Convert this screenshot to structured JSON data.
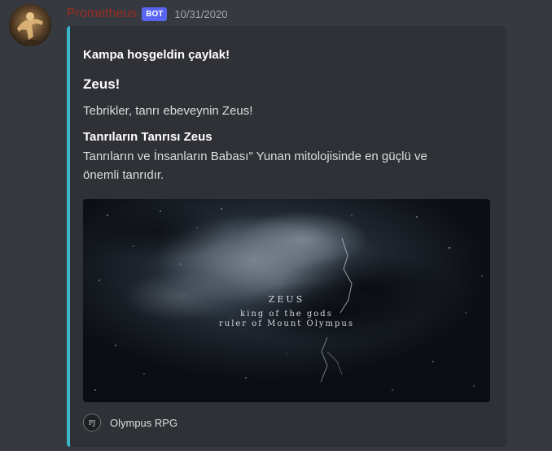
{
  "message": {
    "username": "Prometheus",
    "bot_tag": "BOT",
    "timestamp": "10/31/2020",
    "username_color": "#992d22"
  },
  "embed": {
    "accent_color": "#3ab7c9",
    "author": "Kampa hoşgeldin çaylak!",
    "title": "Zeus!",
    "description": "Tebrikler, tanrı ebeveynin Zeus!",
    "field": {
      "name": "Tanrıların Tanrısı Zeus",
      "value": "Tanrıların ve İnsanların Babası\" Yunan mitolojisinde en güçlü ve önemli tanrıdır."
    },
    "image": {
      "title": "ZEUS",
      "line1": "king of the gods",
      "line2": "ruler of Mount Olympus"
    },
    "footer": {
      "icon_text": "PJ",
      "text": "Olympus RPG"
    }
  }
}
